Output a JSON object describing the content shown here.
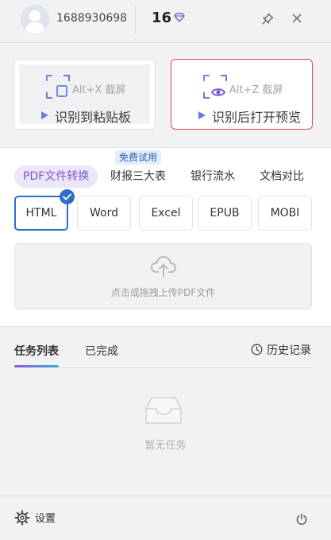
{
  "header": {
    "user_id": "1688930698",
    "credits": "16",
    "accent_color": "#7b5cd6"
  },
  "capture": {
    "clipboard": {
      "shortcut": "Alt+X 截屏",
      "label": "识别到粘贴板"
    },
    "preview": {
      "shortcut": "Alt+Z 截屏",
      "label": "识别后打开预览"
    }
  },
  "convert": {
    "trial_badge": "免费试用",
    "categories": [
      "PDF文件转换",
      "财报三大表",
      "银行流水",
      "文档对比"
    ],
    "active_category": "PDF文件转换",
    "formats": [
      "HTML",
      "Word",
      "Excel",
      "EPUB",
      "MOBI"
    ],
    "selected_format": "HTML",
    "upload_hint": "点击或拖拽上传PDF文件"
  },
  "tasks": {
    "tabs": [
      "任务列表",
      "已完成"
    ],
    "active_tab": "任务列表",
    "history": "历史记录",
    "empty": "暂无任务"
  },
  "footer": {
    "settings": "设置"
  }
}
